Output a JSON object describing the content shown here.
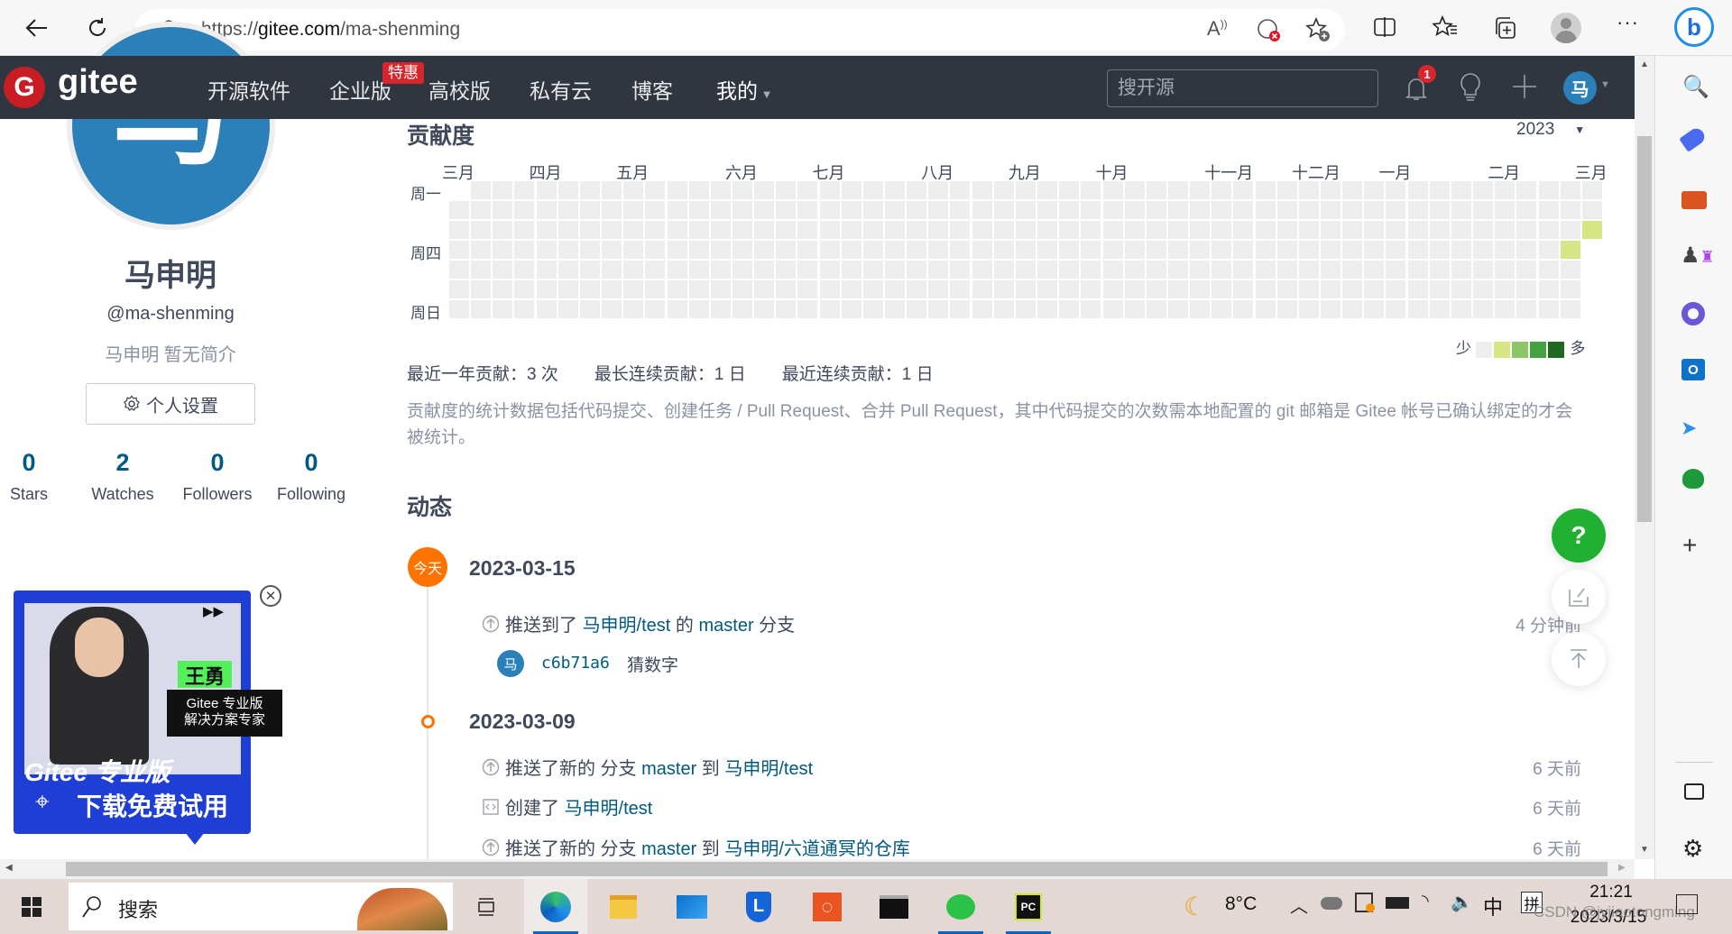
{
  "browser": {
    "url_prefix": "https://",
    "url_host": "gitee.com",
    "url_path": "/ma-shenming",
    "icons": [
      "back-icon",
      "refresh-icon",
      "lock-icon",
      "read-aloud-icon",
      "tracking-blocked-icon",
      "add-favorite-icon",
      "split-screen-icon",
      "favorites-icon",
      "collections-icon",
      "profile-icon",
      "more-icon",
      "bing-icon"
    ]
  },
  "nav": {
    "logo": "gitee",
    "items": [
      {
        "label": "开源软件"
      },
      {
        "label": "企业版"
      },
      {
        "label": "高校版"
      },
      {
        "label": "私有云"
      },
      {
        "label": "博客"
      },
      {
        "label": "我的"
      }
    ],
    "promo_badge": "特惠",
    "search_placeholder": "搜开源",
    "notification_count": "1",
    "avatar_letter": "马",
    "brand_color": "#c71d23"
  },
  "profile": {
    "avatar_letter": "马",
    "name": "马申明",
    "username": "@ma-shenming",
    "bio": "马申明 暂无简介",
    "settings_label": "个人设置",
    "stats": [
      {
        "value": "0",
        "label": "Stars"
      },
      {
        "value": "2",
        "label": "Watches"
      },
      {
        "value": "0",
        "label": "Followers"
      },
      {
        "value": "0",
        "label": "Following"
      }
    ]
  },
  "ad": {
    "name": "王勇",
    "role_line1": "Gitee 专业版",
    "role_line2": "解决方案专家",
    "headline1": "Gitee 专业版",
    "headline2": "下载免费试用"
  },
  "contrib": {
    "title": "贡献度",
    "year": "2023",
    "months": [
      "三月",
      "四月",
      "五月",
      "六月",
      "七月",
      "八月",
      "九月",
      "十月",
      "十一月",
      "十二月",
      "一月",
      "二月",
      "三月"
    ],
    "weekdays": [
      "周一",
      "周四",
      "周日"
    ],
    "active_days": [
      {
        "date": "2023-03-09",
        "level": 1
      },
      {
        "date": "2023-03-15",
        "level": 1
      }
    ],
    "legend_less": "少",
    "legend_more": "多",
    "level_colors": [
      "#eeeeee",
      "#d6e685",
      "#8cc665",
      "#44a340",
      "#1e6823"
    ],
    "summary": [
      {
        "text": "最近一年贡献：3 次"
      },
      {
        "text": "最长连续贡献：1 日"
      },
      {
        "text": "最近连续贡献：1 日"
      }
    ],
    "note": "贡献度的统计数据包括代码提交、创建任务 / Pull Request、合并 Pull Request，其中代码提交的次数需本地配置的 git 邮箱是 Gitee 帐号已确认绑定的才会被统计。"
  },
  "feed": {
    "title": "动态",
    "today_badge": "今天",
    "groups": [
      {
        "date": "2023-03-15",
        "events": [
          {
            "icon": "push-icon",
            "parts": [
              "推送到了 ",
              "马申明/test",
              " 的 ",
              "master",
              " 分支"
            ],
            "time": "4 分钟前",
            "commit": {
              "avatar": "马",
              "hash": "c6b71a6",
              "message": "猜数字"
            }
          }
        ]
      },
      {
        "date": "2023-03-09",
        "events": [
          {
            "icon": "push-icon",
            "parts": [
              "推送了新的 分支 ",
              "master",
              " 到 ",
              "马申明/test",
              ""
            ],
            "time": "6 天前"
          },
          {
            "icon": "repo-icon",
            "parts": [
              "创建了 ",
              "马申明/test",
              "",
              "",
              ""
            ],
            "time": "6 天前"
          },
          {
            "icon": "push-icon",
            "parts": [
              "推送了新的 分支 ",
              "master",
              " 到 ",
              "马申明/六道通冥的仓库",
              ""
            ],
            "time": "6 天前"
          }
        ]
      }
    ]
  },
  "taskbar": {
    "search_label": "搜索",
    "weather": "8°C",
    "ime_lang": "中",
    "ime_mode": "拼",
    "time": "21:21",
    "date": "2023/3/15",
    "watermark": "CSDN @jyjiaotongming"
  }
}
